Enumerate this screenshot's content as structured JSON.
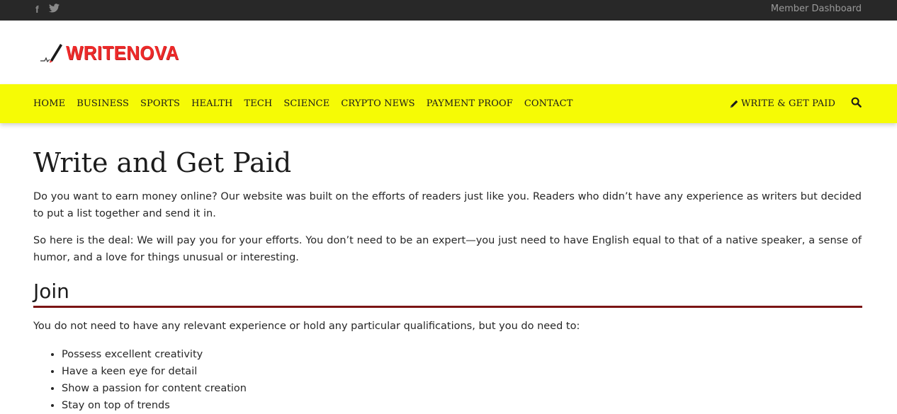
{
  "topbar": {
    "social": [
      {
        "icon": "facebook-icon",
        "glyph": "f"
      },
      {
        "icon": "twitter-icon",
        "glyph": "🐦"
      }
    ],
    "member_link": "Member Dashboard"
  },
  "header": {
    "logo_text": "WRITENOVA",
    "brand_color": "#ee2a2a"
  },
  "nav": {
    "items": [
      "HOME",
      "BUSINESS",
      "SPORTS",
      "HEALTH",
      "TECH",
      "SCIENCE",
      "CRYPTO NEWS",
      "PAYMENT PROOF",
      "CONTACT"
    ],
    "write_get_paid": "WRITE & GET PAID",
    "search_icon": "search-icon",
    "bg_color": "#f6fb05"
  },
  "article": {
    "title": "Write and Get Paid",
    "paragraph_1": "Do you want to earn money online? Our website was built on the efforts of readers just like you. Readers who didn’t have any experience as writers but decided to put a list together and send it in.",
    "paragraph_2": "So here is the deal: We will pay you for your efforts. You don’t need to be an expert—you just need to have English equal to that of a native speaker, a sense of humor, and a love for things unusual or interesting.",
    "join_heading": "Join",
    "join_text": "You do not need to have any relevant experience or hold any particular qualifications, but you do need to:",
    "requirements": [
      "Possess excellent creativity",
      "Have a keen eye for detail",
      "Show a passion for content creation",
      "Stay on top of trends"
    ]
  }
}
